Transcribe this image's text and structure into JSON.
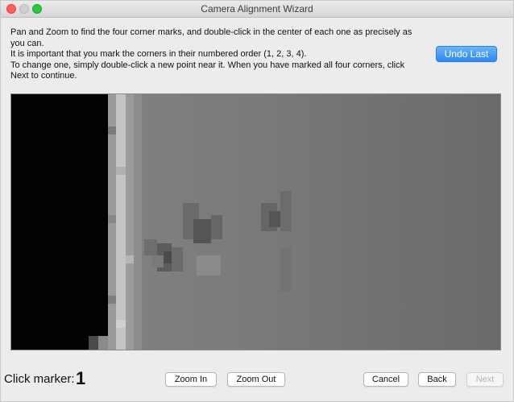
{
  "window": {
    "title": "Camera Alignment Wizard"
  },
  "instructions": {
    "text": "Pan and Zoom to find the four corner marks, and double-click in the center of each one as precisely as\nyou can.\nIt is important that you mark the corners in their numbered order (1, 2, 3, 4).\nTo change one, simply double-click a new point near it.  When you have marked all four corners, click\nNext to continue."
  },
  "buttons": {
    "undo_last": "Undo Last",
    "zoom_in": "Zoom In",
    "zoom_out": "Zoom Out",
    "cancel": "Cancel",
    "back": "Back",
    "next": "Next"
  },
  "marker": {
    "label": "Click marker:",
    "number": "1"
  },
  "colors": {
    "accent": "#2b88f5",
    "close": "#ff5f57",
    "maximize": "#28c840"
  }
}
